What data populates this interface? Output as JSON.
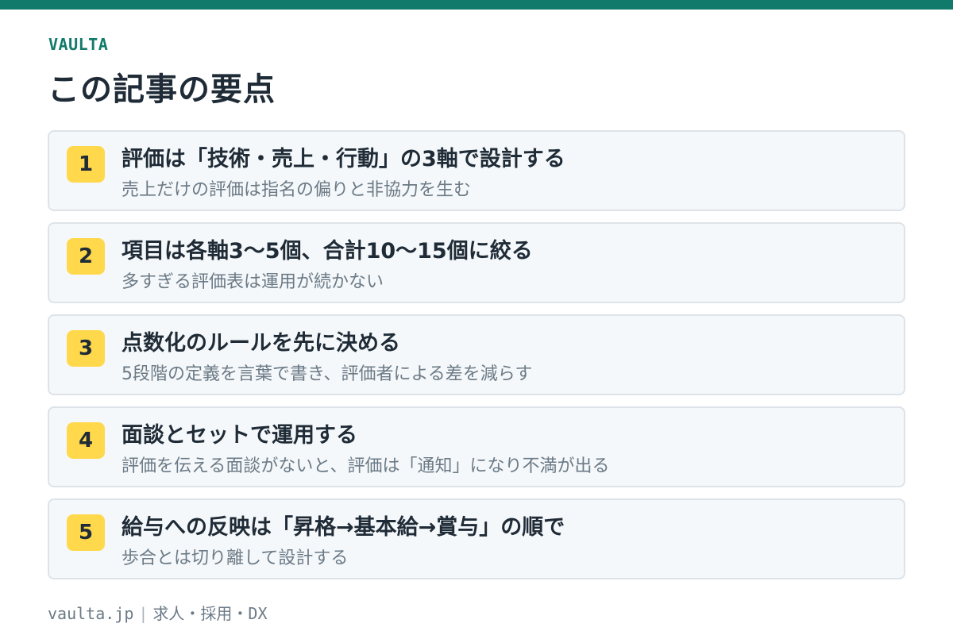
{
  "brand": "VAULTA",
  "title": "この記事の要点",
  "items": [
    {
      "number": "1",
      "title": "評価は「技術・売上・行動」の3軸で設計する",
      "subtitle": "売上だけの評価は指名の偏りと非協力を生む"
    },
    {
      "number": "2",
      "title": "項目は各軸3〜5個、合計10〜15個に絞る",
      "subtitle": "多すぎる評価表は運用が続かない"
    },
    {
      "number": "3",
      "title": "点数化のルールを先に決める",
      "subtitle": "5段階の定義を言葉で書き、評価者による差を減らす"
    },
    {
      "number": "4",
      "title": "面談とセットで運用する",
      "subtitle": "評価を伝える面談がないと、評価は「通知」になり不満が出る"
    },
    {
      "number": "5",
      "title": "給与への反映は「昇格→基本給→賞与」の順で",
      "subtitle": "歩合とは切り離して設計する"
    }
  ],
  "footer": {
    "site": "vaulta.jp",
    "separator": "|",
    "tagline": "求人・採用・DX"
  },
  "colors": {
    "accent": "#127a6a",
    "badge": "#ffd84c",
    "card_bg": "#f5f8fa",
    "card_border": "#dde3e8"
  }
}
